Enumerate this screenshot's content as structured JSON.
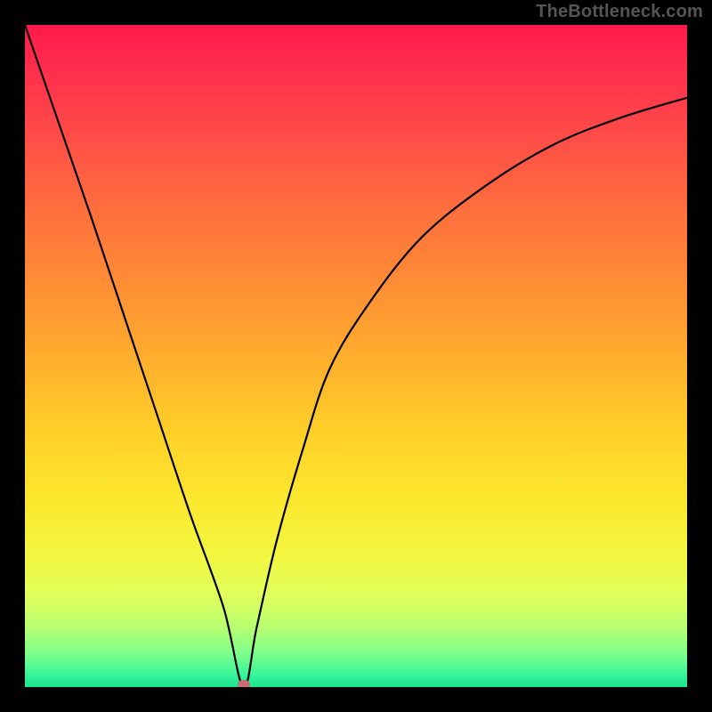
{
  "watermark_text": "TheBottleneck.com",
  "chart_data": {
    "type": "line",
    "title": "",
    "xlabel": "",
    "ylabel": "",
    "xlim": [
      0,
      100
    ],
    "ylim": [
      0,
      100
    ],
    "grid": false,
    "legend": false,
    "background": "rainbow-gradient-vertical",
    "series": [
      {
        "name": "bottleneck-curve",
        "x": [
          0,
          5,
          10,
          15,
          20,
          25,
          30,
          33,
          35,
          38,
          42,
          46,
          52,
          60,
          70,
          80,
          90,
          100
        ],
        "y": [
          100,
          85.5,
          71,
          56,
          41,
          26,
          12,
          0,
          9,
          22,
          36,
          48,
          58,
          68,
          76,
          82,
          86,
          89
        ]
      }
    ],
    "marker": {
      "x": 33,
      "y": 0,
      "shape": "ellipse",
      "color": "#cc6b74"
    }
  },
  "colors": {
    "frame": "#000000",
    "watermark": "#555555",
    "curve": "#000000",
    "marker": "#cc6b74"
  }
}
